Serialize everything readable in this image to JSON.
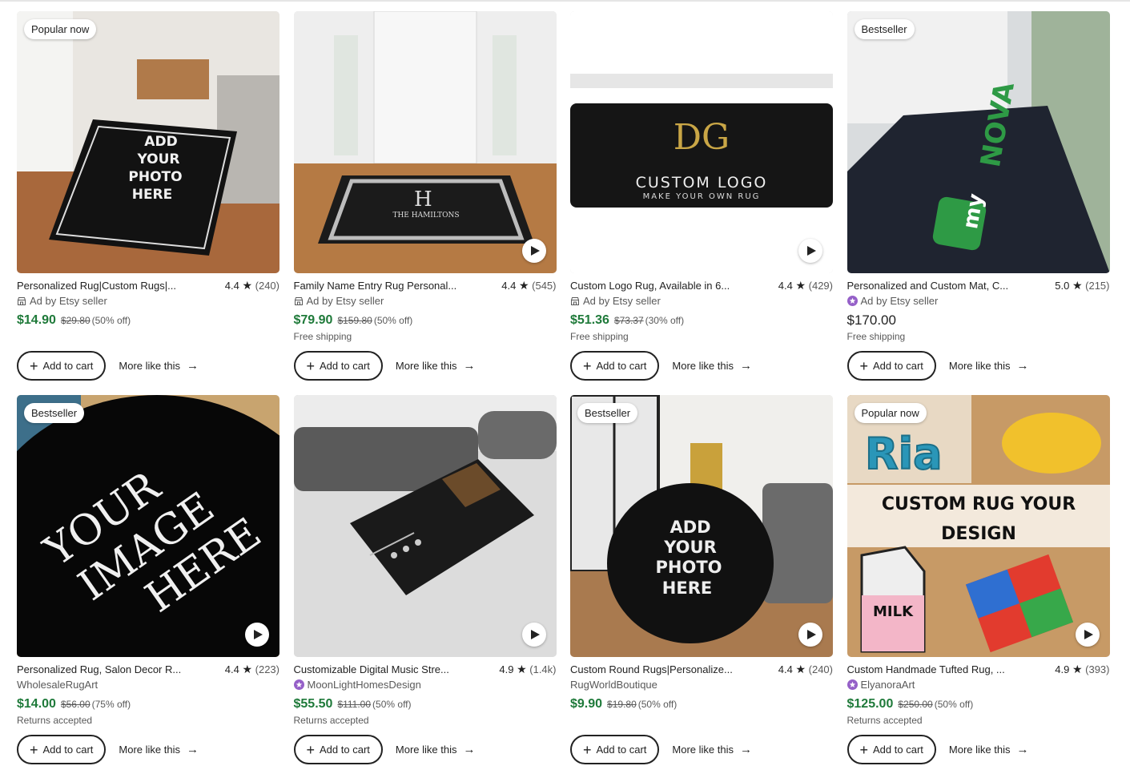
{
  "accent_green": "#1f7a3a",
  "star_seller_color": "#9560c8",
  "listings": [
    {
      "badge": "Popular now",
      "title": "Personalized Rug|Custom Rugs|...",
      "rating": "4.4",
      "reviews": "(240)",
      "seller": "Ad by Etsy seller",
      "seller_icon": "shop-icon",
      "price": "$14.90",
      "original_price": "$29.80",
      "discount": "(50% off)",
      "note": "",
      "video": false,
      "image_text": [
        "ADD",
        "YOUR",
        "PHOTO",
        "HERE"
      ],
      "add_to_cart": "Add to cart",
      "more_like_this": "More like this"
    },
    {
      "badge": "",
      "title": "Family Name Entry Rug Personal...",
      "rating": "4.4",
      "reviews": "(545)",
      "seller": "Ad by Etsy seller",
      "seller_icon": "shop-icon",
      "price": "$79.90",
      "original_price": "$159.80",
      "discount": "(50% off)",
      "note": "Free shipping",
      "video": true,
      "image_text": [
        "H",
        "THE HAMILTONS"
      ],
      "add_to_cart": "Add to cart",
      "more_like_this": "More like this"
    },
    {
      "badge": "",
      "title": "Custom Logo Rug, Available in 6...",
      "rating": "4.4",
      "reviews": "(429)",
      "seller": "Ad by Etsy seller",
      "seller_icon": "shop-icon",
      "price": "$51.36",
      "original_price": "$73.37",
      "discount": "(30% off)",
      "note": "Free shipping",
      "video": true,
      "image_text": [
        "DG",
        "CUSTOM LOGO",
        "MAKE YOUR OWN RUG"
      ],
      "add_to_cart": "Add to cart",
      "more_like_this": "More like this"
    },
    {
      "badge": "Bestseller",
      "title": "Personalized and Custom Mat, C...",
      "rating": "5.0",
      "reviews": "(215)",
      "seller": "Ad by Etsy seller",
      "seller_icon": "star-seller-icon",
      "price": "$170.00",
      "original_price": "",
      "discount": "",
      "note": "Free shipping",
      "video": false,
      "image_text": [
        "my",
        "NOVA"
      ],
      "add_to_cart": "Add to cart",
      "more_like_this": "More like this"
    },
    {
      "badge": "Bestseller",
      "title": "Personalized Rug, Salon Decor R...",
      "rating": "4.4",
      "reviews": "(223)",
      "seller": "WholesaleRugArt",
      "seller_icon": "",
      "price": "$14.00",
      "original_price": "$56.00",
      "discount": "(75% off)",
      "note": "Returns accepted",
      "video": true,
      "image_text": [
        "YOUR",
        "IMAGE",
        "HERE"
      ],
      "add_to_cart": "Add to cart",
      "more_like_this": "More like this"
    },
    {
      "badge": "",
      "title": "Customizable Digital Music Stre...",
      "rating": "4.9",
      "reviews": "(1.4k)",
      "seller": "MoonLightHomesDesign",
      "seller_icon": "star-seller-icon",
      "price": "$55.50",
      "original_price": "$111.00",
      "discount": "(50% off)",
      "note": "Returns accepted",
      "video": true,
      "image_text": [],
      "add_to_cart": "Add to cart",
      "more_like_this": "More like this"
    },
    {
      "badge": "Bestseller",
      "title": "Custom Round Rugs|Personalize...",
      "rating": "4.4",
      "reviews": "(240)",
      "seller": "RugWorldBoutique",
      "seller_icon": "",
      "price": "$9.90",
      "original_price": "$19.80",
      "discount": "(50% off)",
      "note": "",
      "video": true,
      "image_text": [
        "ADD",
        "YOUR",
        "PHOTO",
        "HERE"
      ],
      "add_to_cart": "Add to cart",
      "more_like_this": "More like this"
    },
    {
      "badge": "Popular now",
      "title": "Custom Handmade Tufted Rug, ...",
      "rating": "4.9",
      "reviews": "(393)",
      "seller": "ElyanoraArt",
      "seller_icon": "star-seller-icon",
      "price": "$125.00",
      "original_price": "$250.00",
      "discount": "(50% off)",
      "note": "Returns accepted",
      "video": true,
      "image_text": [
        "Ria",
        "CUSTOM RUG YOUR",
        "DESIGN",
        "MILK"
      ],
      "add_to_cart": "Add to cart",
      "more_like_this": "More like this"
    }
  ]
}
